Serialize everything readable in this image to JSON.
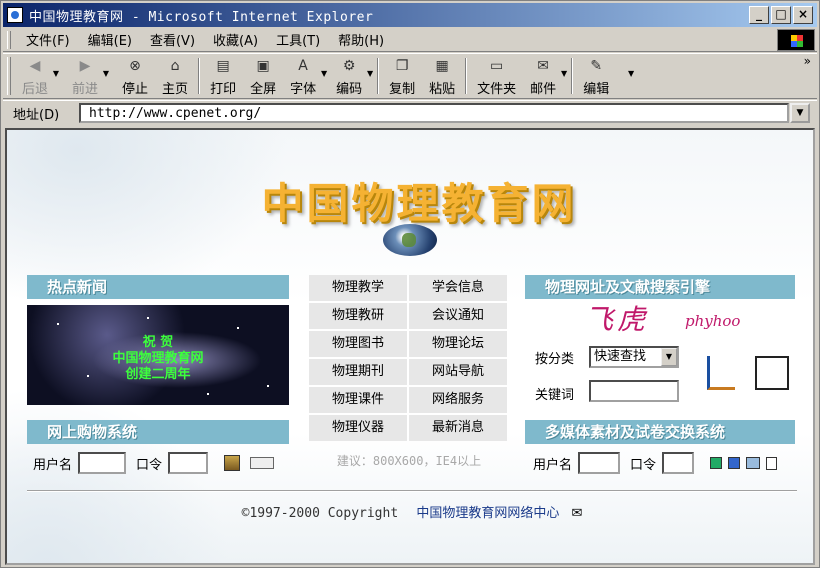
{
  "window": {
    "title": "中国物理教育网 - Microsoft Internet Explorer",
    "buttons": {
      "minimize": "_",
      "maximize": "□",
      "close": "×"
    }
  },
  "menu": [
    {
      "label": "文件(F)"
    },
    {
      "label": "编辑(E)"
    },
    {
      "label": "查看(V)"
    },
    {
      "label": "收藏(A)"
    },
    {
      "label": "工具(T)"
    },
    {
      "label": "帮助(H)"
    }
  ],
  "toolbar": {
    "back": "后退",
    "forward": "前进",
    "stop": "停止",
    "home": "主页",
    "print": "打印",
    "fullscreen": "全屏",
    "font": "字体",
    "encoding": "编码",
    "copy": "复制",
    "paste": "粘贴",
    "folder": "文件夹",
    "mail": "邮件",
    "edit": "编辑",
    "more": "»"
  },
  "address": {
    "label": "地址(D)",
    "url": "http://www.cpenet.org/"
  },
  "page": {
    "site_title": "中国物理教育网",
    "hot_news": {
      "header": "热点新闻",
      "greeting_1": "祝  贺",
      "greeting_2": "中国物理教育网",
      "greeting_3": "创建二周年"
    },
    "shopping": {
      "header": "网上购物系统",
      "user_label": "用户名",
      "pass_label": "口令"
    },
    "nav": {
      "left": [
        "物理教学",
        "物理教研",
        "物理图书",
        "物理期刊",
        "物理课件",
        "物理仪器"
      ],
      "right": [
        "学会信息",
        "会议通知",
        "物理论坛",
        "网站导航",
        "网络服务",
        "最新消息"
      ]
    },
    "hint": "建议：800X600，IE4以上",
    "search": {
      "header": "物理网址及文献搜索引擎",
      "brand_cn": "飞虎",
      "brand_en": "phyhoo",
      "category_label": "按分类",
      "category_value": "快速查找",
      "keyword_label": "关键词"
    },
    "multimedia": {
      "header": "多媒体素材及试卷交换系统",
      "user_label": "用户名",
      "pass_label": "口令"
    },
    "footer": {
      "copyright": "©1997-2000 Copyright",
      "center": "中国物理教育网网络中心"
    }
  },
  "colors": {
    "section_header": "#7fb9cc",
    "title_gold": "#f5b233",
    "brand_magenta": "#c0186a",
    "greeting_green": "#3cff3c",
    "nav_cell": "#e7e7e7"
  }
}
